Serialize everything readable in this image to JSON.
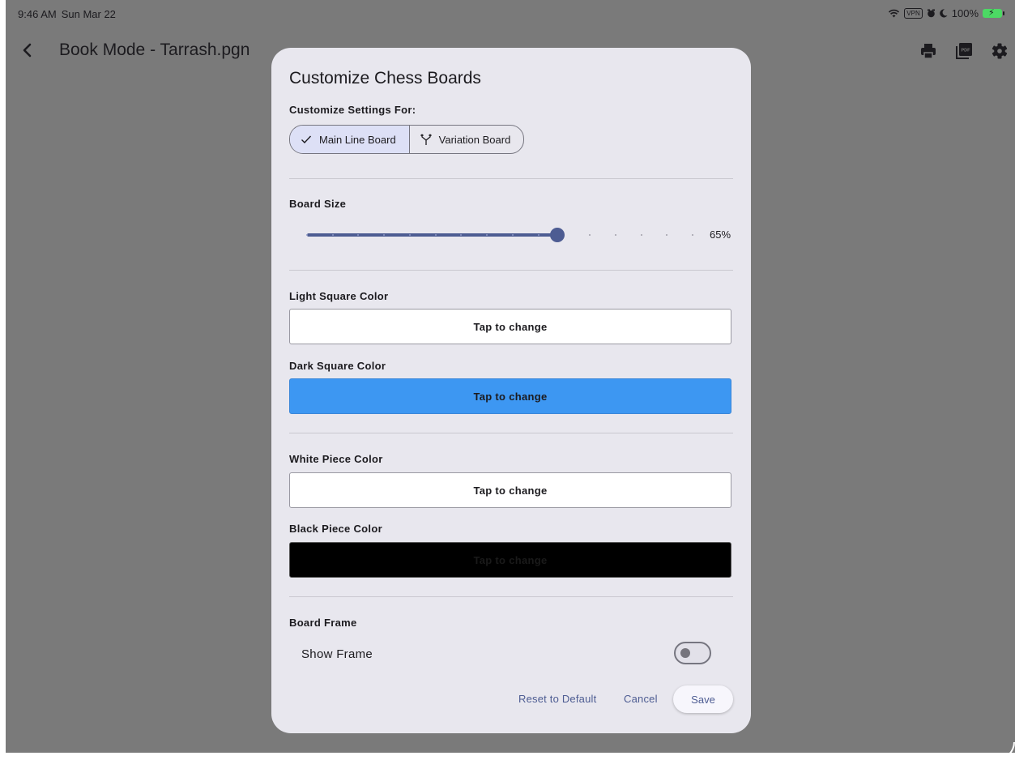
{
  "status_bar": {
    "time": "9:46 AM",
    "date": "Sun Mar 22",
    "vpn": "VPN",
    "battery": "100%"
  },
  "app_bar": {
    "title": "Book Mode - Tarrash.pgn",
    "actions": [
      "print-icon",
      "pdf-icon",
      "gear-icon"
    ],
    "pdf_badge": "PDF"
  },
  "dialog": {
    "title": "Customize Chess Boards",
    "customize_for_label": "Customize Settings For:",
    "segments": [
      {
        "label": "Main Line Board",
        "icon": "check-icon",
        "selected": true
      },
      {
        "label": "Variation Board",
        "icon": "branch-icon",
        "selected": false
      }
    ],
    "board_size": {
      "label": "Board Size",
      "value_text": "65%",
      "value": 65
    },
    "colors": {
      "light_square": {
        "label": "Light Square Color",
        "button": "Tap to change",
        "color": "#ffffff"
      },
      "dark_square": {
        "label": "Dark Square Color",
        "button": "Tap to change",
        "color": "#3d97f2"
      },
      "white_piece": {
        "label": "White Piece Color",
        "button": "Tap to change",
        "color": "#ffffff"
      },
      "black_piece": {
        "label": "Black Piece Color",
        "button": "Tap to change",
        "color": "#000000"
      }
    },
    "board_frame": {
      "label": "Board Frame",
      "show_frame_label": "Show Frame",
      "show_frame": false
    },
    "buttons": {
      "reset": "Reset to Default",
      "cancel": "Cancel",
      "save": "Save"
    }
  },
  "theme": {
    "accent": "#4d5c92",
    "scrim": "#7a7a7a",
    "dialog_bg": "#e8e7ee"
  }
}
